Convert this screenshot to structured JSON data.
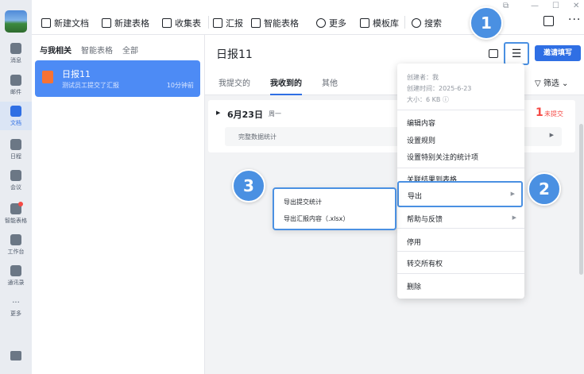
{
  "rail": {
    "items": [
      {
        "label": "消息"
      },
      {
        "label": "邮件"
      },
      {
        "label": "文档"
      },
      {
        "label": "日程"
      },
      {
        "label": "会议"
      },
      {
        "label": "智能表格"
      },
      {
        "label": "工作台"
      },
      {
        "label": "通讯录"
      },
      {
        "label": "更多"
      }
    ]
  },
  "toolbar": {
    "new_doc": "新建文档",
    "new_sheet": "新建表格",
    "collect": "收集表",
    "report": "汇报",
    "smart_sheet": "智能表格",
    "more": "更多",
    "templates": "模板库",
    "search": "搜索"
  },
  "list": {
    "tabs": [
      "与我相关",
      "智能表格",
      "全部"
    ],
    "item": {
      "title": "日报11",
      "subtitle": "测试员工提交了汇报",
      "time": "10分钟前"
    }
  },
  "main": {
    "title": "日报11",
    "tabs": [
      "我提交的",
      "我收到的",
      "其他"
    ],
    "invite": "邀请填写",
    "filter": "筛选",
    "date": "6月23日",
    "weekday": "周一",
    "unsubmitted_count": "1",
    "unsubmitted_label": "未提交",
    "stats": "完整数据统计"
  },
  "menu": {
    "creator": "创建者：我",
    "created": "创建时间：2025-6-23",
    "size": "大小：6 KB ⓘ",
    "edit": "编辑内容",
    "rules": "设置规则",
    "stat_items": "设置特别关注的统计项",
    "link_sheet": "关联结果到表格",
    "export": "导出",
    "help": "帮助与反馈",
    "disable": "停用",
    "transfer": "转交所有权",
    "delete": "删除"
  },
  "submenu": {
    "export_stats": "导出提交统计",
    "export_content": "导出汇报内容（.xlsx）"
  },
  "badges": [
    "1",
    "2",
    "3"
  ],
  "colors": {
    "accent": "#2f6fe4",
    "badge": "#4a90e2",
    "warn": "#f54a45"
  }
}
